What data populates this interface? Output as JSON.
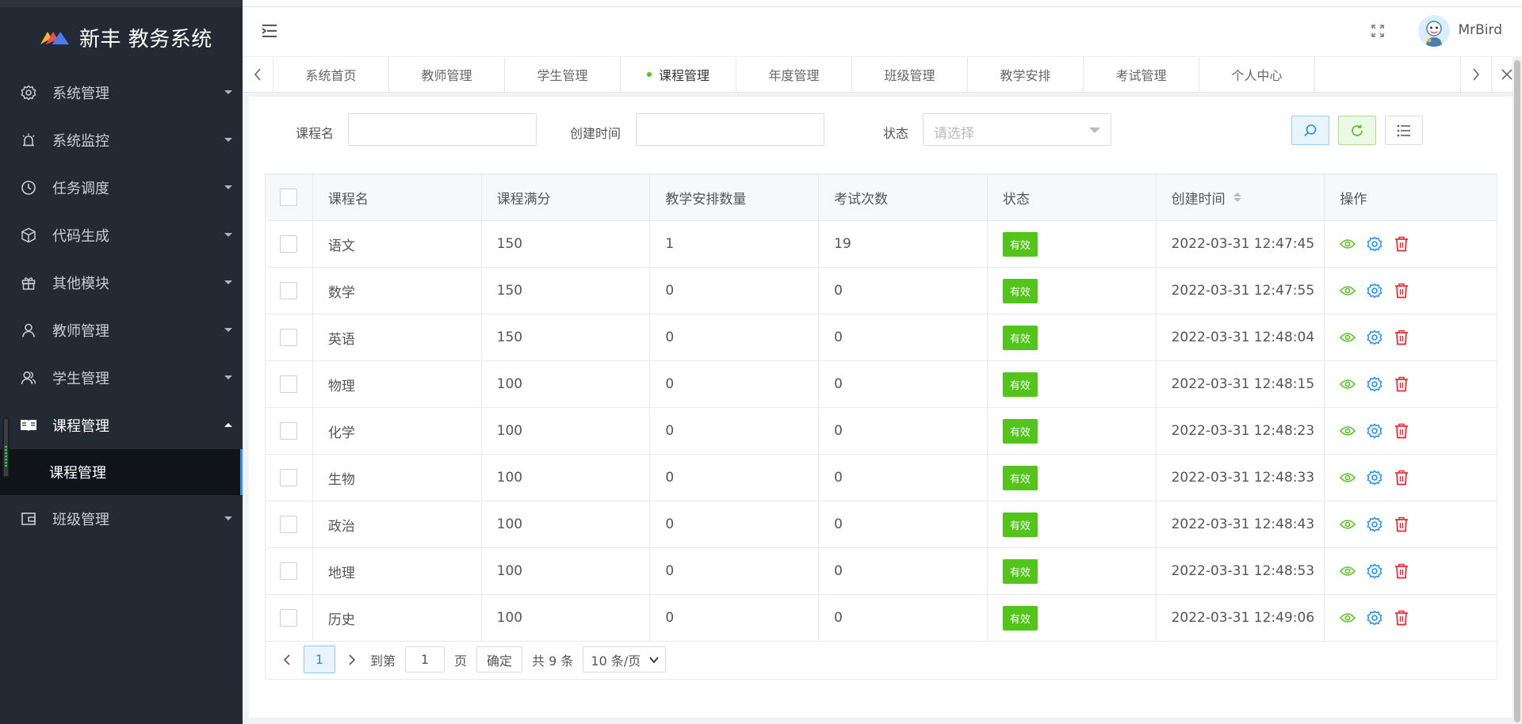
{
  "app": {
    "title": "新丰 教务系统"
  },
  "sidebar": {
    "items": [
      {
        "label": "系统管理",
        "icon": "gear-icon"
      },
      {
        "label": "系统监控",
        "icon": "alarm-icon"
      },
      {
        "label": "任务调度",
        "icon": "clock-icon"
      },
      {
        "label": "代码生成",
        "icon": "cube-icon"
      },
      {
        "label": "其他模块",
        "icon": "gift-icon"
      },
      {
        "label": "教师管理",
        "icon": "user-icon"
      },
      {
        "label": "学生管理",
        "icon": "users-icon"
      },
      {
        "label": "课程管理",
        "icon": "book-icon"
      },
      {
        "label": "班级管理",
        "icon": "wallet-icon"
      }
    ],
    "submenu": {
      "label": "课程管理"
    }
  },
  "header": {
    "username": "MrBird"
  },
  "tabs": {
    "items": [
      "系统首页",
      "教师管理",
      "学生管理",
      "课程管理",
      "年度管理",
      "班级管理",
      "教学安排",
      "考试管理",
      "个人中心"
    ],
    "active": "课程管理"
  },
  "search": {
    "course_label": "课程名",
    "created_label": "创建时间",
    "status_label": "状态",
    "status_placeholder": "请选择"
  },
  "table": {
    "headers": [
      "课程名",
      "课程满分",
      "教学安排数量",
      "考试次数",
      "状态",
      "创建时间",
      "操作"
    ],
    "rows": [
      {
        "name": "语文",
        "full": "150",
        "plans": "1",
        "exams": "19",
        "status": "有效",
        "created": "2022-03-31 12:47:45"
      },
      {
        "name": "数学",
        "full": "150",
        "plans": "0",
        "exams": "0",
        "status": "有效",
        "created": "2022-03-31 12:47:55"
      },
      {
        "name": "英语",
        "full": "150",
        "plans": "0",
        "exams": "0",
        "status": "有效",
        "created": "2022-03-31 12:48:04"
      },
      {
        "name": "物理",
        "full": "100",
        "plans": "0",
        "exams": "0",
        "status": "有效",
        "created": "2022-03-31 12:48:15"
      },
      {
        "name": "化学",
        "full": "100",
        "plans": "0",
        "exams": "0",
        "status": "有效",
        "created": "2022-03-31 12:48:23"
      },
      {
        "name": "生物",
        "full": "100",
        "plans": "0",
        "exams": "0",
        "status": "有效",
        "created": "2022-03-31 12:48:33"
      },
      {
        "name": "政治",
        "full": "100",
        "plans": "0",
        "exams": "0",
        "status": "有效",
        "created": "2022-03-31 12:48:43"
      },
      {
        "name": "地理",
        "full": "100",
        "plans": "0",
        "exams": "0",
        "status": "有效",
        "created": "2022-03-31 12:48:53"
      },
      {
        "name": "历史",
        "full": "100",
        "plans": "0",
        "exams": "0",
        "status": "有效",
        "created": "2022-03-31 12:49:06"
      }
    ]
  },
  "pager": {
    "current": "1",
    "goto_label": "到第",
    "goto_value": "1",
    "page_label": "页",
    "confirm": "确定",
    "total": "共 9 条",
    "page_size": "10 条/页"
  },
  "colors": {
    "sidebar_bg": "#232a33",
    "accent": "#1890ff",
    "success": "#52c41a",
    "danger": "#f5222d"
  }
}
